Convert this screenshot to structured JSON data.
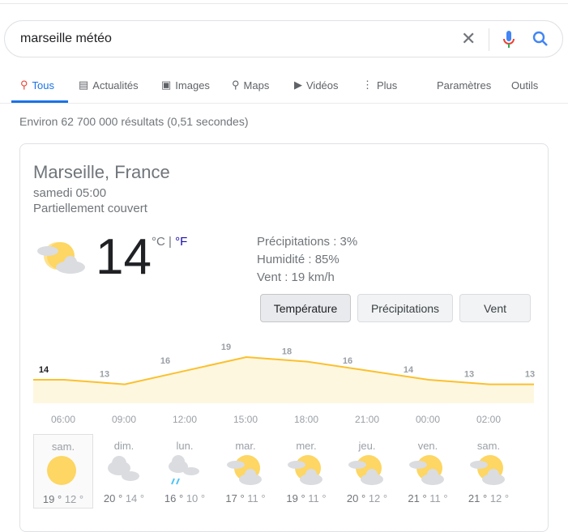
{
  "search": {
    "query": "marseille météo",
    "clear_icon": "close-icon",
    "voice_icon": "mic-icon",
    "search_icon": "search-icon"
  },
  "tabs": [
    {
      "label": "Tous",
      "icon": "search-icon",
      "active": true
    },
    {
      "label": "Actualités",
      "icon": "news-icon"
    },
    {
      "label": "Images",
      "icon": "image-icon"
    },
    {
      "label": "Maps",
      "icon": "map-pin-icon"
    },
    {
      "label": "Vidéos",
      "icon": "play-icon"
    },
    {
      "label": "Plus",
      "icon": "more-vert-icon"
    }
  ],
  "tools": {
    "settings": "Paramètres",
    "tools": "Outils"
  },
  "stats": "Environ 62 700 000 résultats (0,51 secondes)",
  "weather": {
    "location": "Marseille, France",
    "datetime": "samedi 05:00",
    "condition": "Partiellement couvert",
    "temperature": "14",
    "unit_c": "°C",
    "unit_sep": " | ",
    "unit_f": "°F",
    "precip": "Précipitations : 3%",
    "humidity": "Humidité : 85%",
    "wind": "Vent : 19 km/h",
    "buttons": [
      "Température",
      "Précipitations",
      "Vent"
    ],
    "accent": "#fbc02d"
  },
  "chart_data": {
    "type": "area",
    "values": [
      14,
      13,
      16,
      19,
      18,
      16,
      14,
      13,
      13
    ],
    "times": [
      "06:00",
      "09:00",
      "12:00",
      "15:00",
      "18:00",
      "21:00",
      "00:00",
      "02:00"
    ]
  },
  "forecast": [
    {
      "day": "sam.",
      "hi": "19 °",
      "lo": "12 °",
      "icon": "sunny"
    },
    {
      "day": "dim.",
      "hi": "20 °",
      "lo": "14 °",
      "icon": "cloudy"
    },
    {
      "day": "lun.",
      "hi": "16 °",
      "lo": "10 °",
      "icon": "rain"
    },
    {
      "day": "mar.",
      "hi": "17 °",
      "lo": "11 °",
      "icon": "partly-cloudy"
    },
    {
      "day": "mer.",
      "hi": "19 °",
      "lo": "11 °",
      "icon": "partly-cloudy"
    },
    {
      "day": "jeu.",
      "hi": "20 °",
      "lo": "12 °",
      "icon": "partly-cloudy"
    },
    {
      "day": "ven.",
      "hi": "21 °",
      "lo": "11 °",
      "icon": "partly-cloudy"
    },
    {
      "day": "sam.",
      "hi": "21 °",
      "lo": "12 °",
      "icon": "partly-cloudy"
    }
  ]
}
